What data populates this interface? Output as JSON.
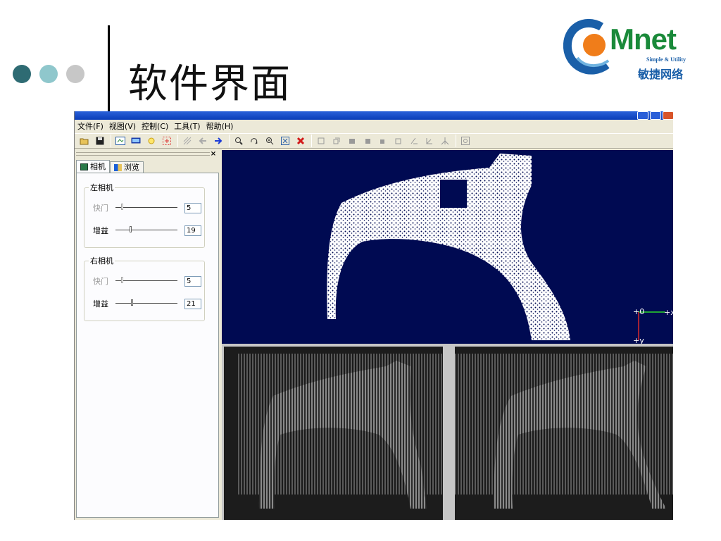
{
  "slide": {
    "title": "软件界面",
    "dot_colors": [
      "#2e6b73",
      "#8fc7cc",
      "#c7c7c7"
    ]
  },
  "logo": {
    "brand": "Mnet",
    "tagline": "Simple & Utility",
    "chinese": "敏捷网络"
  },
  "window": {
    "menus": [
      "文件(F)",
      "视图(V)",
      "控制(C)",
      "工具(T)",
      "帮助(H)"
    ],
    "toolbar_icons": [
      "open-icon",
      "save-icon",
      "camera-view-icon",
      "display-icon",
      "light-icon",
      "crosshair-icon",
      "grid-icon",
      "back-arrow-icon",
      "forward-arrow-icon",
      "zoom-icon",
      "rotate-icon",
      "zoom-in-icon",
      "fit-view-icon",
      "delete-icon",
      "view-top-icon",
      "view-front-icon",
      "view-left-icon",
      "view-right-icon",
      "view-back-icon",
      "view-bottom-icon",
      "axis-x-icon",
      "axis-y-icon",
      "axis-z-icon",
      "zoom-window-icon"
    ]
  },
  "left_panel": {
    "tabs": [
      "相机",
      "浏览"
    ],
    "left_camera": {
      "title": "左相机",
      "shutter_label": "快门",
      "shutter_value": "5",
      "gain_label": "增益",
      "gain_value": "19"
    },
    "right_camera": {
      "title": "右相机",
      "shutter_label": "快门",
      "shutter_value": "5",
      "gain_label": "增益",
      "gain_value": "21"
    }
  },
  "view3d": {
    "axis_x": "+x",
    "axis_y": "+y",
    "axis_origin": "+0"
  }
}
